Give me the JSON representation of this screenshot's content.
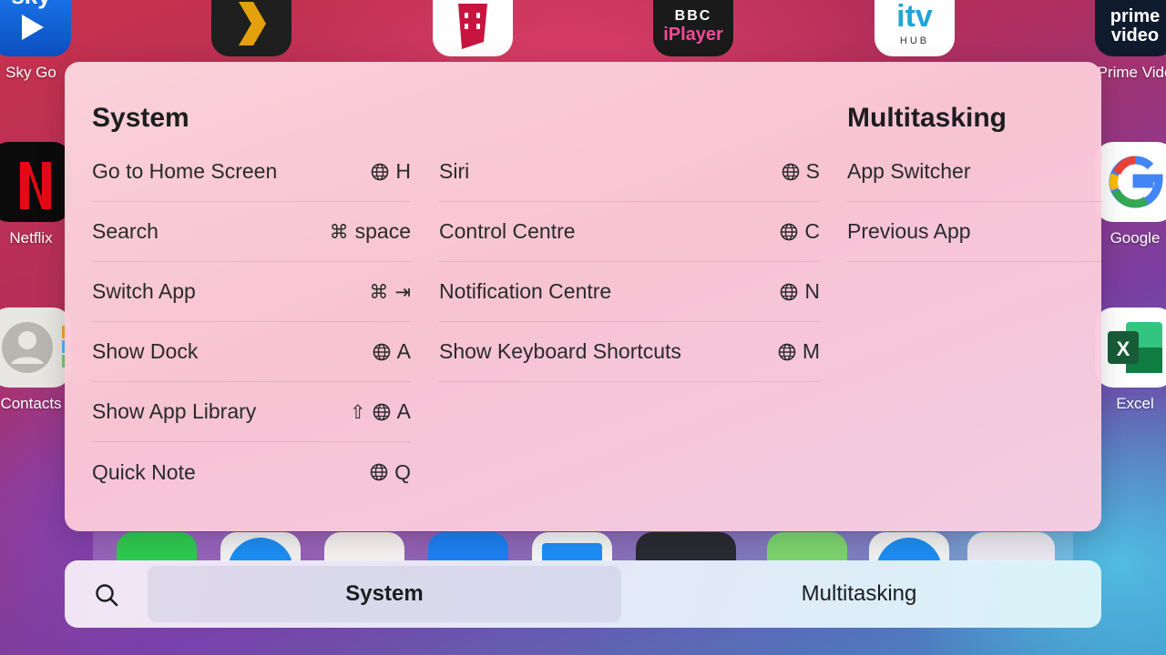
{
  "home_apps": {
    "sky_go": "Sky Go",
    "netflix": "Netflix",
    "contacts": "Contacts",
    "google": "Google",
    "excel": "Excel",
    "prime_video": "Prime Vide",
    "bbc_tile_top": "BBC",
    "bbc_tile_bottom": "iPlayer",
    "itv_tile_top": "itv",
    "itv_tile_bottom": "HUB",
    "prime_tile_top": "prime",
    "prime_tile_bottom": "video",
    "sky_tile": "sky",
    "excel_tile": "X"
  },
  "panel": {
    "system_title": "System",
    "multitasking_title": "Multitasking",
    "system_col1": [
      {
        "label": "Go to Home Screen",
        "key": "H"
      },
      {
        "label": "Search",
        "mod": "⌘",
        "key": "space"
      },
      {
        "label": "Switch App",
        "mod": "⌘",
        "key": "⇥"
      },
      {
        "label": "Show Dock",
        "key": "A"
      },
      {
        "label": "Show App Library",
        "mod": "⇧",
        "key": "A"
      },
      {
        "label": "Quick Note",
        "key": "Q"
      }
    ],
    "system_col2": [
      {
        "label": "Siri",
        "key": "S"
      },
      {
        "label": "Control Centre",
        "key": "C"
      },
      {
        "label": "Notification Centre",
        "key": "N"
      },
      {
        "label": "Show Keyboard Shortcuts",
        "key": "M"
      }
    ],
    "multitasking_items": [
      {
        "label": "App Switcher"
      },
      {
        "label": "Previous App"
      }
    ]
  },
  "tabbar": {
    "tabs": [
      {
        "label": "System",
        "selected": true
      },
      {
        "label": "Multitasking",
        "selected": false
      }
    ]
  },
  "colors": {
    "panel_bg": "#fbd3dd",
    "text": "#1d1d1f",
    "netflix_red": "#e50914",
    "excel_green": "#1d6f42"
  }
}
